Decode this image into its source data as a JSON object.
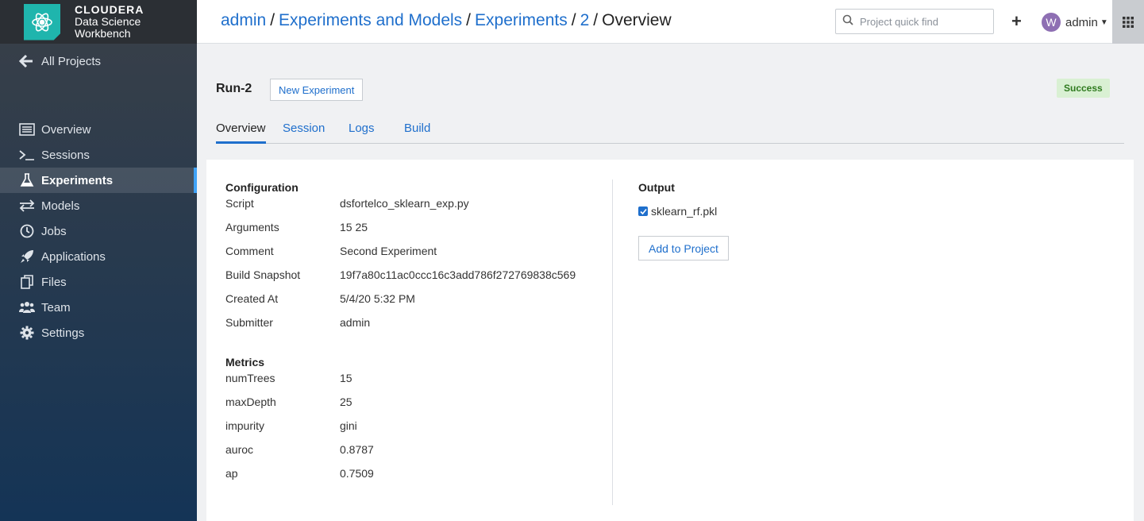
{
  "brand": {
    "line1": "CLOUDERA",
    "line2": "Data Science",
    "line3": "Workbench"
  },
  "sidebar": {
    "all_projects": "All Projects",
    "items": [
      {
        "label": "Overview",
        "icon": "list-icon"
      },
      {
        "label": "Sessions",
        "icon": "terminal-icon"
      },
      {
        "label": "Experiments",
        "icon": "flask-icon",
        "active": true
      },
      {
        "label": "Models",
        "icon": "arrows-icon"
      },
      {
        "label": "Jobs",
        "icon": "clock-icon"
      },
      {
        "label": "Applications",
        "icon": "rocket-icon"
      },
      {
        "label": "Files",
        "icon": "files-icon"
      },
      {
        "label": "Team",
        "icon": "team-icon"
      },
      {
        "label": "Settings",
        "icon": "gear-icon"
      }
    ]
  },
  "header": {
    "breadcrumb": [
      "admin",
      "Experiments and Models",
      "Experiments",
      "2",
      "Overview"
    ],
    "search_placeholder": "Project quick find",
    "avatar_letter": "W",
    "user": "admin"
  },
  "run": {
    "title": "Run-2",
    "new_experiment": "New Experiment",
    "status": "Success"
  },
  "tabs": [
    "Overview",
    "Session",
    "Logs",
    "Build"
  ],
  "configuration": {
    "title": "Configuration",
    "rows": [
      {
        "key": "Script",
        "value": "dsfortelco_sklearn_exp.py"
      },
      {
        "key": "Arguments",
        "value": "15 25"
      },
      {
        "key": "Comment",
        "value": "Second Experiment"
      },
      {
        "key": "Build Snapshot",
        "value": "19f7a80c11ac0ccc16c3add786f272769838c569"
      },
      {
        "key": "Created At",
        "value": "5/4/20 5:32 PM"
      },
      {
        "key": "Submitter",
        "value": "admin"
      }
    ]
  },
  "metrics": {
    "title": "Metrics",
    "rows": [
      {
        "key": "numTrees",
        "value": "15"
      },
      {
        "key": "maxDepth",
        "value": "25"
      },
      {
        "key": "impurity",
        "value": "gini"
      },
      {
        "key": "auroc",
        "value": "0.8787"
      },
      {
        "key": "ap",
        "value": "0.7509"
      }
    ]
  },
  "output": {
    "title": "Output",
    "file": "sklearn_rf.pkl",
    "checked": true,
    "add_button": "Add to Project"
  },
  "colors": {
    "accent": "#1f6fcc",
    "success_bg": "#d9f0d3",
    "success_text": "#2f7a1f"
  }
}
